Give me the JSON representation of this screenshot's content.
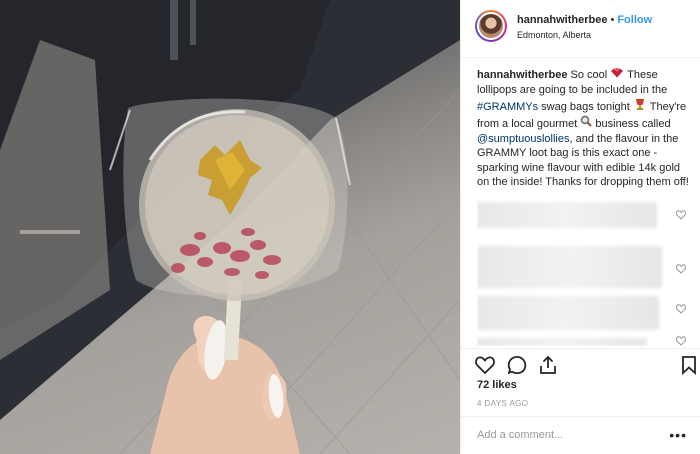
{
  "post": {
    "username": "hannahwitherbee",
    "separator": "•",
    "follow_label": "Follow",
    "location": "Edmonton, Alberta",
    "caption_user": "hannahwitherbee",
    "caption_part1": "So cool ",
    "caption_part2": " These lollipops are going to be included in the ",
    "caption_hashtag": "#GRAMMYs",
    "caption_part3": " swag bags tonight ",
    "caption_part4": " They're from a local gourmet ",
    "caption_part5": " business called ",
    "caption_mention": "@sumptuouslollies",
    "caption_part6": ", and the flavour in the GRAMMY loot bag is this exact one - sparking wine flavour with edible 14k gold on the inside! Thanks for dropping them off!",
    "likes": "72 likes",
    "timestamp": "4 DAYS AGO",
    "add_comment_placeholder": "Add a comment...",
    "more_options": "•••"
  },
  "icons": {
    "heart": "heart-icon",
    "comment": "comment-icon",
    "share": "share-icon",
    "bookmark": "bookmark-icon",
    "emoji_1": "gem-heart-emoji",
    "emoji_2": "trophy-emoji",
    "emoji_3": "magnifier-emoji"
  },
  "colors": {
    "link": "#003569",
    "follow": "#3897f0",
    "muted": "#999999",
    "border": "#efefef"
  }
}
